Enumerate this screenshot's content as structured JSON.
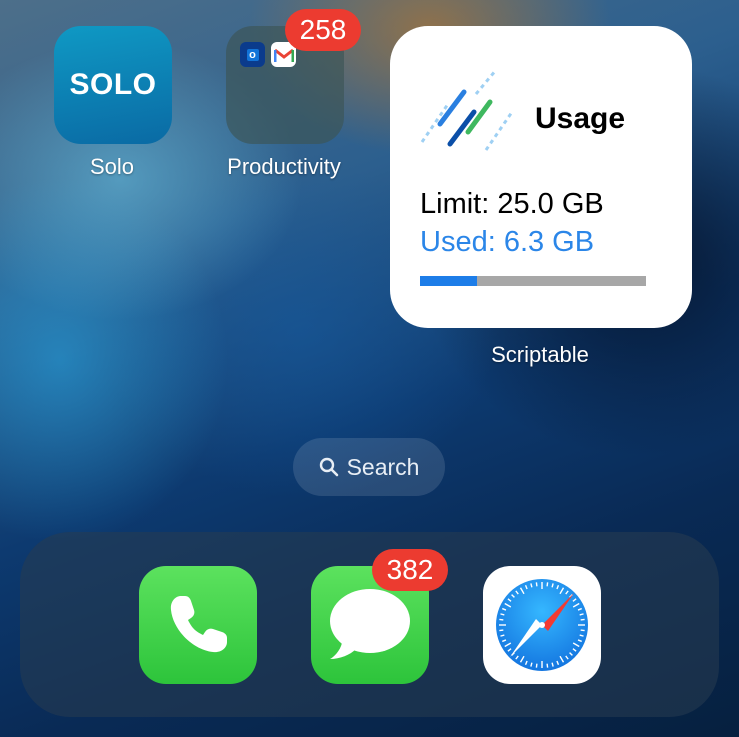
{
  "home": {
    "apps": [
      {
        "label": "Solo",
        "logo_text": "SOLO",
        "icon": "solo-app-icon"
      },
      {
        "label": "Productivity",
        "badge": "258",
        "icon": "folder-icon",
        "folder_apps": [
          "outlook-icon",
          "gmail-icon"
        ]
      }
    ],
    "widget": {
      "title": "Usage",
      "limit_text": "Limit: 25.0 GB",
      "used_text": "Used: 6.3 GB",
      "progress_fraction": 0.252,
      "label": "Scriptable",
      "colors": {
        "used": "#2b86e8",
        "bar_fill": "#1d7de8",
        "bar_track": "#a7a7a7"
      }
    },
    "search": {
      "label": "Search",
      "icon": "search-icon"
    }
  },
  "dock": {
    "apps": [
      {
        "name": "Phone",
        "icon": "phone-icon"
      },
      {
        "name": "Messages",
        "badge": "382",
        "icon": "messages-icon"
      },
      {
        "name": "Safari",
        "icon": "safari-icon"
      }
    ]
  },
  "colors": {
    "badge": "#ec3b30",
    "app_green": "#2dc43b"
  }
}
